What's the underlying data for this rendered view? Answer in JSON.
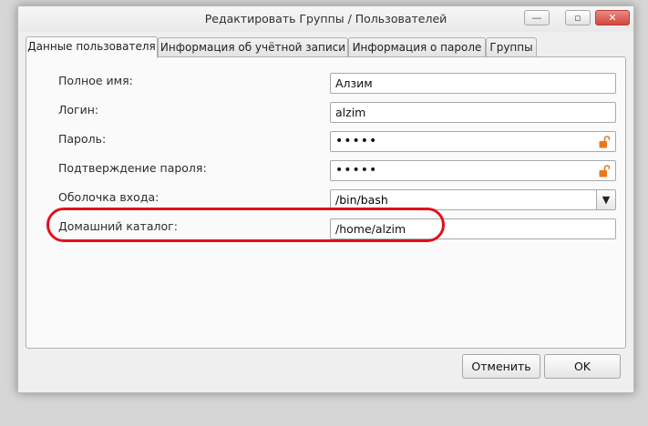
{
  "window": {
    "title": "Редактировать Группы / Пользователей",
    "minimize_glyph": "—",
    "maximize_glyph": "▫",
    "close_glyph": "✕"
  },
  "tabs": [
    {
      "label": "Данные пользователя",
      "active": true
    },
    {
      "label": "Информация об учётной записи",
      "active": false
    },
    {
      "label": "Информация о пароле",
      "active": false
    },
    {
      "label": "Группы",
      "active": false
    }
  ],
  "form": {
    "full_name": {
      "label": "Полное имя:",
      "value": "Алзим"
    },
    "login": {
      "label": "Логин:",
      "value": "alzim"
    },
    "password": {
      "label": "Пароль:",
      "value": "•••••",
      "icon": "unlocked-padlock-icon"
    },
    "confirm_password": {
      "label": "Подтверждение пароля:",
      "value": "•••••",
      "icon": "unlocked-padlock-icon"
    },
    "shell": {
      "label": "Оболочка входа:",
      "value": "/bin/bash"
    },
    "home_dir": {
      "label": "Домашний каталог:",
      "value": "/home/alzim"
    }
  },
  "buttons": {
    "cancel": "Отменить",
    "ok": "OK"
  },
  "colors": {
    "highlight": "#e2101b",
    "lock": "#e8771f"
  }
}
